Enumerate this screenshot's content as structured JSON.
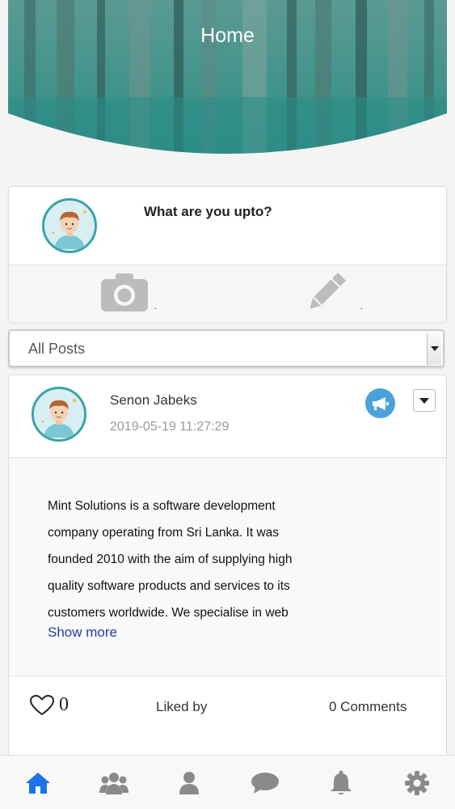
{
  "header": {
    "title": "Home"
  },
  "composer": {
    "prompt": "What are you upto?",
    "photo_action_icon": "camera-icon",
    "write_action_icon": "pencil-icon",
    "photo_suffix": ".",
    "write_suffix": "."
  },
  "filter": {
    "selected": "All Posts"
  },
  "post": {
    "author": "Senon Jabeks",
    "timestamp": "2019-05-19 11:27:29",
    "lines": [
      "Mint Solutions is a software development",
      "company operating from Sri Lanka. It was",
      "founded 2010 with the aim of supplying high",
      "quality software products and services to its",
      "customers worldwide. We specialise in web"
    ],
    "show_more": "Show more",
    "like_count": "0",
    "liked_by": "Liked by",
    "comments": "0 Comments"
  },
  "bottom_nav": {
    "items": [
      "home-icon",
      "group-icon",
      "user-icon",
      "chat-icon",
      "bell-icon",
      "gear-icon"
    ],
    "active": "home-icon"
  },
  "colors": {
    "accent": "#1a73e8",
    "avatar_ring": "#3aa3a8",
    "megaphone": "#4aa3d8",
    "nav_inactive": "#8a8a8a"
  }
}
